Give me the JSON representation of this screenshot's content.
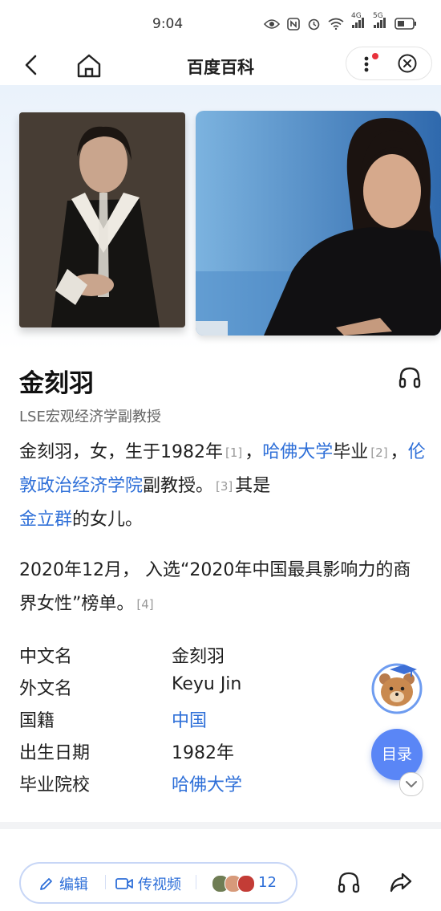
{
  "status": {
    "time": "9:04",
    "signal1": "4G",
    "signal2": "5G"
  },
  "nav": {
    "title": "百度百科"
  },
  "person": {
    "name": "金刻羽",
    "subtitle": "LSE宏观经济学副教授"
  },
  "intro": {
    "p1_a": "金刻羽，女，生于1982年",
    "ref1": "[1]",
    "p1_b": "，",
    "link_harvard": "哈佛大学",
    "p1_c": "毕业",
    "ref2": "[2]",
    "p1_d": "，",
    "link_lse": "伦敦政治经济学院",
    "p1_e": "副教授。",
    "ref3": "[3]",
    "p1_f": "其是",
    "link_father": "金立群",
    "p1_g": "的女儿。",
    "p2": "2020年12月， 入选“2020年中国最具影响力的商界女性”榜单。",
    "ref4": "[4]"
  },
  "infobox": [
    {
      "key": "中文名",
      "value": "金刻羽",
      "link": false
    },
    {
      "key": "外文名",
      "value": "Keyu Jin",
      "link": false
    },
    {
      "key": "国籍",
      "value": "中国",
      "link": true
    },
    {
      "key": "出生日期",
      "value": "1982年",
      "link": false
    },
    {
      "key": "毕业院校",
      "value": "哈佛大学",
      "link": true
    }
  ],
  "floating": {
    "toc_label": "目录"
  },
  "bottom": {
    "edit_label": "编辑",
    "video_label": "传视频",
    "contributors_count": "12"
  },
  "colors": {
    "link": "#2e6fd8",
    "toc": "#5a86f6",
    "red_dot": "#e8323c"
  }
}
